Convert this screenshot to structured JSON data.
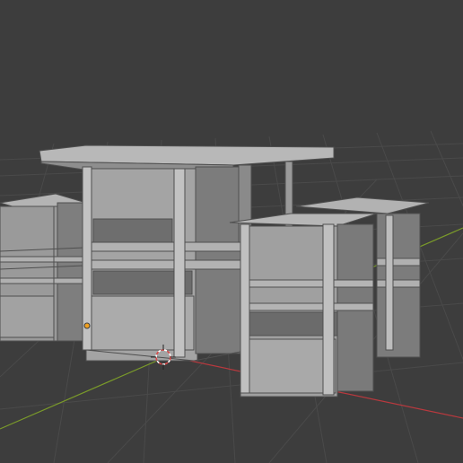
{
  "viewport": {
    "background": "#3d3d3d",
    "grid_color": "#4a4a4a",
    "x_axis_color": "#b8393e",
    "y_axis_color": "#7a9a2a"
  },
  "model": {
    "face_light": "#a8a8a8",
    "face_mid": "#8f8f8f",
    "face_dark": "#6c6c6c",
    "edge": "#4f4f4f"
  },
  "origin_marker_color": "#f0a020",
  "cursor_3d_color": "#d84848"
}
